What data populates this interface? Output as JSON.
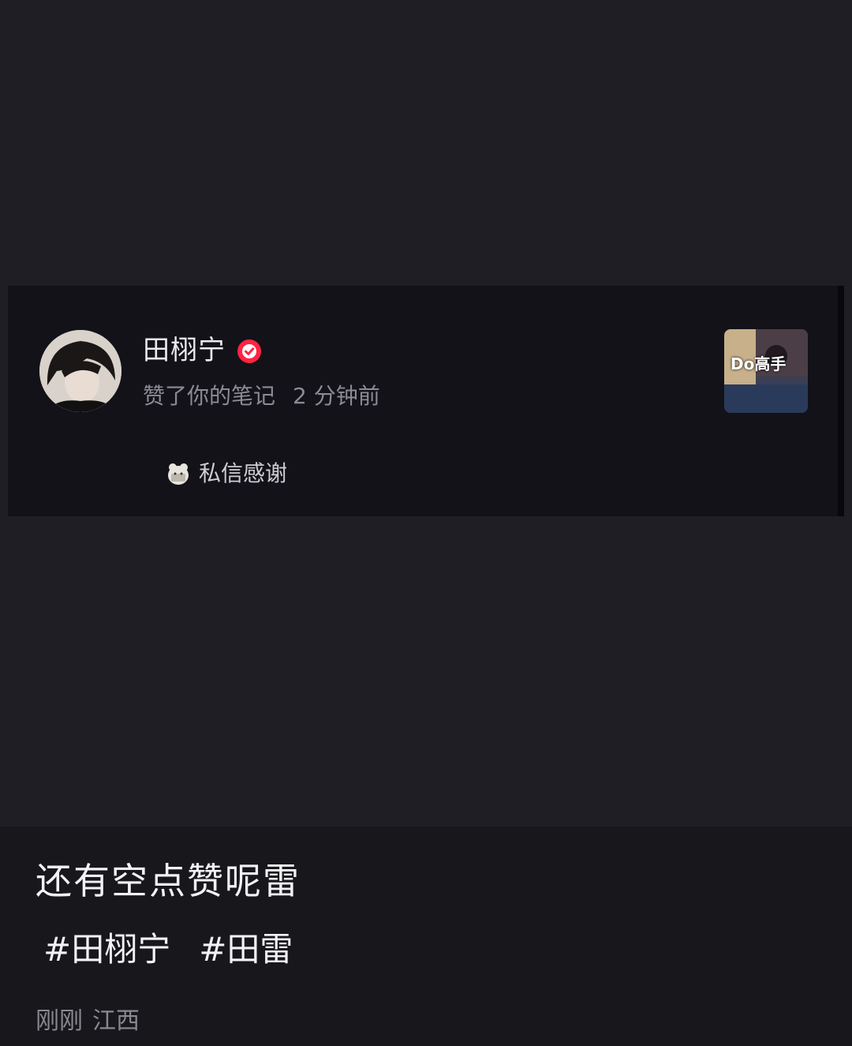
{
  "notification": {
    "user_name": "田栩宁",
    "action": "赞了你的笔记",
    "time": "2 分钟前",
    "dm_button": "私信感谢",
    "thumbnail_label": "Do高手",
    "verified_badge": "verified-check-icon",
    "dm_icon": "message-bear-icon"
  },
  "post": {
    "caption": "还有空点赞呢雷",
    "tags": [
      "#田栩宁",
      "#田雷"
    ],
    "time": "刚刚",
    "location": "江西"
  },
  "colors": {
    "background": "#1f1e24",
    "card": "#131219",
    "badge_red": "#ff2442",
    "secondary_text": "#8c8a93"
  }
}
